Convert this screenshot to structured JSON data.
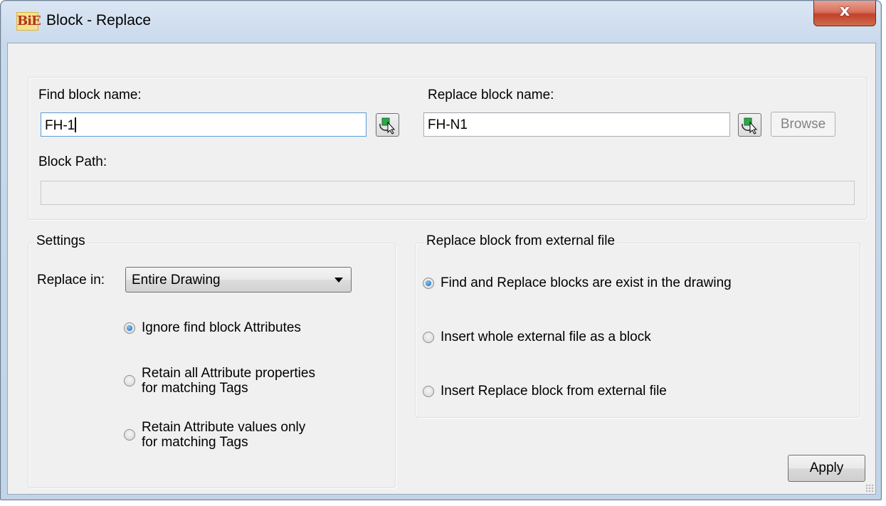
{
  "window": {
    "title": "Block - Replace",
    "icon": "BiE",
    "close_glyph": "x"
  },
  "find": {
    "label": "Find block name:",
    "value": "FH-1"
  },
  "replace": {
    "label": "Replace block name:",
    "value": "FH-N1",
    "browse_label": "Browse"
  },
  "block_path": {
    "label": "Block Path:",
    "value": ""
  },
  "settings": {
    "legend": "Settings",
    "replace_in_label": "Replace in:",
    "replace_in_value": "Entire Drawing",
    "options": [
      {
        "line1": "Ignore find block Attributes",
        "line2": "",
        "checked": true
      },
      {
        "line1": "Retain all Attribute properties",
        "line2": "for matching Tags",
        "checked": false
      },
      {
        "line1": "Retain Attribute values only",
        "line2": "for matching Tags",
        "checked": false
      }
    ]
  },
  "external": {
    "legend": "Replace block from external file",
    "options": [
      {
        "label": "Find and Replace blocks are exist in the drawing",
        "checked": true
      },
      {
        "label": "Insert whole external file as a block",
        "checked": false
      },
      {
        "label": "Insert Replace block from external file",
        "checked": false
      }
    ]
  },
  "apply_label": "Apply",
  "colors": {
    "title_bar": "#c9d9ec",
    "close_button": "#c2422c",
    "dialog_bg": "#f0f0f0",
    "radio_selected": "#1e5fb5"
  },
  "icons": {
    "pick_object": "pick-object-icon",
    "dropdown": "chevron-down-icon"
  }
}
